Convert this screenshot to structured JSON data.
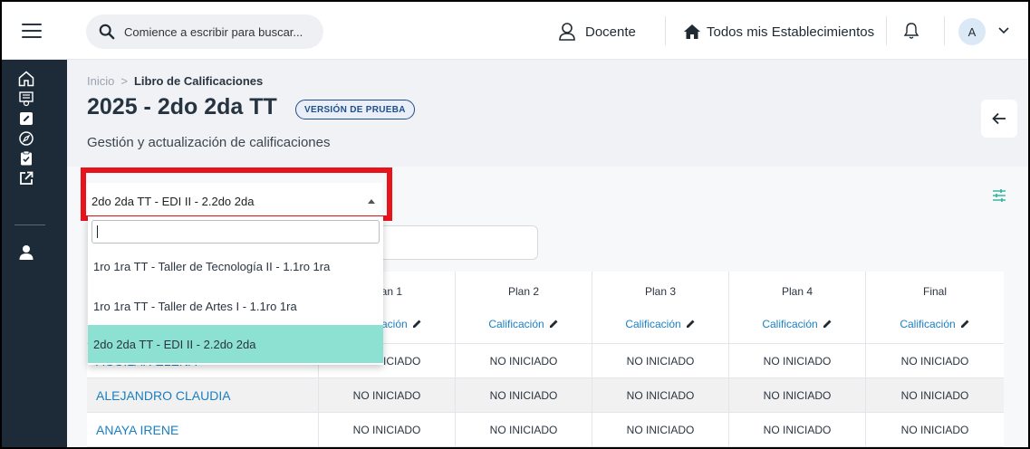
{
  "header": {
    "search_placeholder": "Comience a escribir para buscar...",
    "role_label": "Docente",
    "establishments_label": "Todos mis Establecimientos",
    "avatar_initial": "A"
  },
  "sidebar": {
    "items": [
      {
        "icon": "home-icon"
      },
      {
        "icon": "certificate-icon"
      },
      {
        "icon": "edit-icon"
      },
      {
        "icon": "compass-icon"
      },
      {
        "icon": "clipboard-check-icon"
      },
      {
        "icon": "external-link-icon"
      },
      {
        "icon": "user-icon"
      }
    ]
  },
  "breadcrumb": {
    "home": "Inicio",
    "separator": ">",
    "current": "Libro de Calificaciones"
  },
  "page": {
    "title": "2025 - 2do 2da TT",
    "badge": "VERSIÓN DE PRUEBA",
    "subtitle": "Gestión y actualización de calificaciones"
  },
  "course_select": {
    "selected": "2do 2da TT - EDI II - 2.2do 2da",
    "search_value": "",
    "options": [
      {
        "label": "1ro 1ra TT - Taller de Tecnología II - 1.1ro 1ra",
        "selected": false
      },
      {
        "label": "1ro 1ra TT - Taller de Artes I - 1.1ro 1ra",
        "selected": false
      },
      {
        "label": "2do 2da TT - EDI II - 2.2do 2da",
        "selected": true
      }
    ]
  },
  "table": {
    "columns": [
      {
        "title": "Plan 1",
        "sub": "Calificación"
      },
      {
        "title": "Plan 2",
        "sub": "Calificación"
      },
      {
        "title": "Plan 3",
        "sub": "Calificación"
      },
      {
        "title": "Plan 4",
        "sub": "Calificación"
      },
      {
        "title": "Final",
        "sub": "Calificación"
      }
    ],
    "rows": [
      {
        "name": "AGUILAR ELENA",
        "cells": [
          "NO INICIADO",
          "NO INICIADO",
          "NO INICIADO",
          "NO INICIADO",
          "NO INICIADO"
        ]
      },
      {
        "name": "ALEJANDRO CLAUDIA",
        "cells": [
          "NO INICIADO",
          "NO INICIADO",
          "NO INICIADO",
          "NO INICIADO",
          "NO INICIADO"
        ]
      },
      {
        "name": "ANAYA IRENE",
        "cells": [
          "NO INICIADO",
          "NO INICIADO",
          "NO INICIADO",
          "NO INICIADO",
          "NO INICIADO"
        ]
      }
    ]
  },
  "colors": {
    "rail": "#1d2b38",
    "accent_link": "#1a7fc1",
    "selected_option": "#8de1d2",
    "highlight": "#e8141c",
    "badge": "#1f4f8b"
  }
}
